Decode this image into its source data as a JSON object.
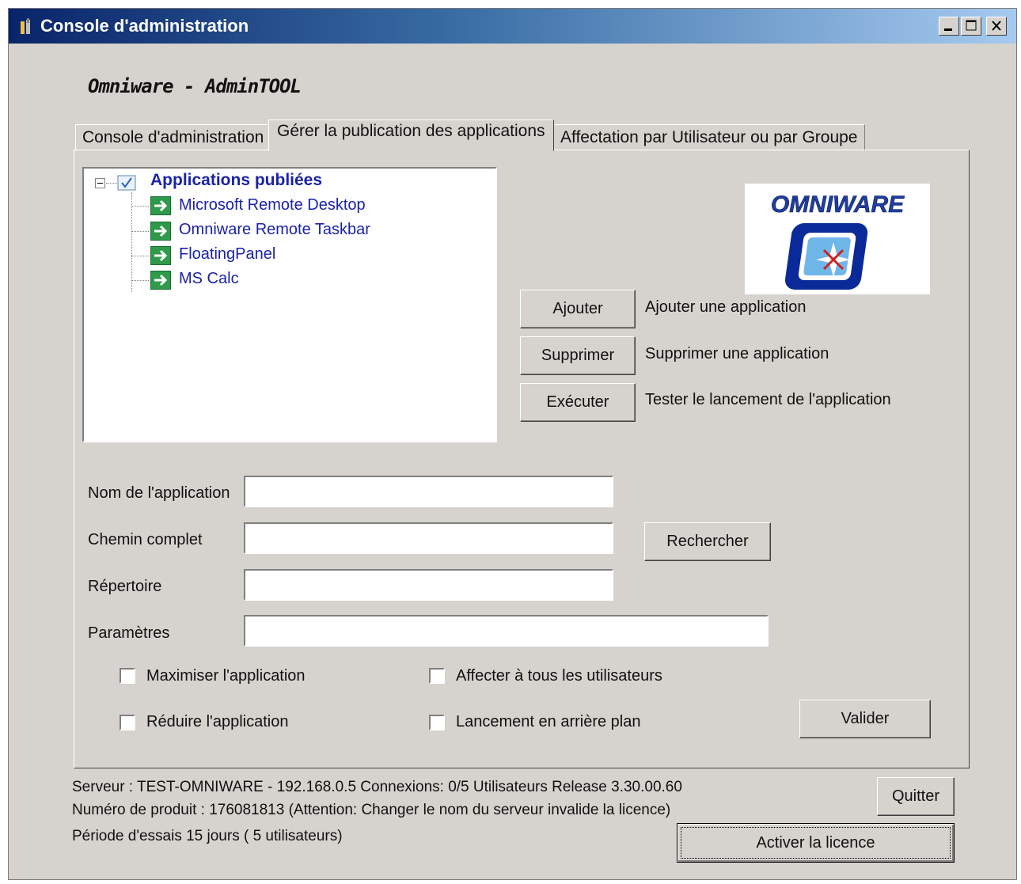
{
  "window": {
    "title": "Console d'administration"
  },
  "app_heading": "Omniware - AdminTOOL",
  "tabs": [
    {
      "label": "Console d'administration",
      "active": false
    },
    {
      "label": "Gérer la publication des applications",
      "active": true
    },
    {
      "label": "Affectation par Utilisateur ou par Groupe",
      "active": false
    }
  ],
  "tree": {
    "root": {
      "label": "Applications publiées",
      "checked": true,
      "expanded": true
    },
    "items": [
      {
        "label": "Microsoft Remote Desktop"
      },
      {
        "label": "Omniware Remote Taskbar"
      },
      {
        "label": "FloatingPanel"
      },
      {
        "label": "MS Calc"
      }
    ]
  },
  "logo": {
    "text": "OMNIWARE",
    "icon": "compass-icon"
  },
  "actions": [
    {
      "button": "Ajouter",
      "description": "Ajouter une application"
    },
    {
      "button": "Supprimer",
      "description": "Supprimer une application"
    },
    {
      "button": "Exécuter",
      "description": "Tester le lancement de l'application"
    }
  ],
  "form": {
    "name_label": "Nom de l'application",
    "name_value": "",
    "path_label": "Chemin complet",
    "path_value": "",
    "browse_button": "Rechercher",
    "dir_label": "Répertoire",
    "dir_value": "",
    "params_label": "Paramètres",
    "params_value": ""
  },
  "options": {
    "maximize": {
      "label": "Maximiser l'application",
      "checked": false
    },
    "minimize": {
      "label": "Réduire l'application",
      "checked": false
    },
    "assign_all": {
      "label": "Affecter à tous les utilisateurs",
      "checked": false
    },
    "background": {
      "label": "Lancement en arrière plan",
      "checked": false
    }
  },
  "validate_button": "Valider",
  "status": {
    "line1": "Serveur : TEST-OMNIWARE  - 192.168.0.5  Connexions: 0/5  Utilisateurs   Release 3.30.00.60",
    "line2": "Numéro de produit : 176081813  (Attention: Changer le nom du serveur invalide la licence)",
    "line3": "Période d'essais 15 jours ( 5 utilisateurs)"
  },
  "quit_button": "Quitter",
  "activate_button": "Activer la licence",
  "colors": {
    "face": "#d6d3ce",
    "title_start": "#0a246a",
    "title_end": "#a6caf0",
    "tree_text": "#1b22a8",
    "arrow_green": "#2e9a4a"
  }
}
